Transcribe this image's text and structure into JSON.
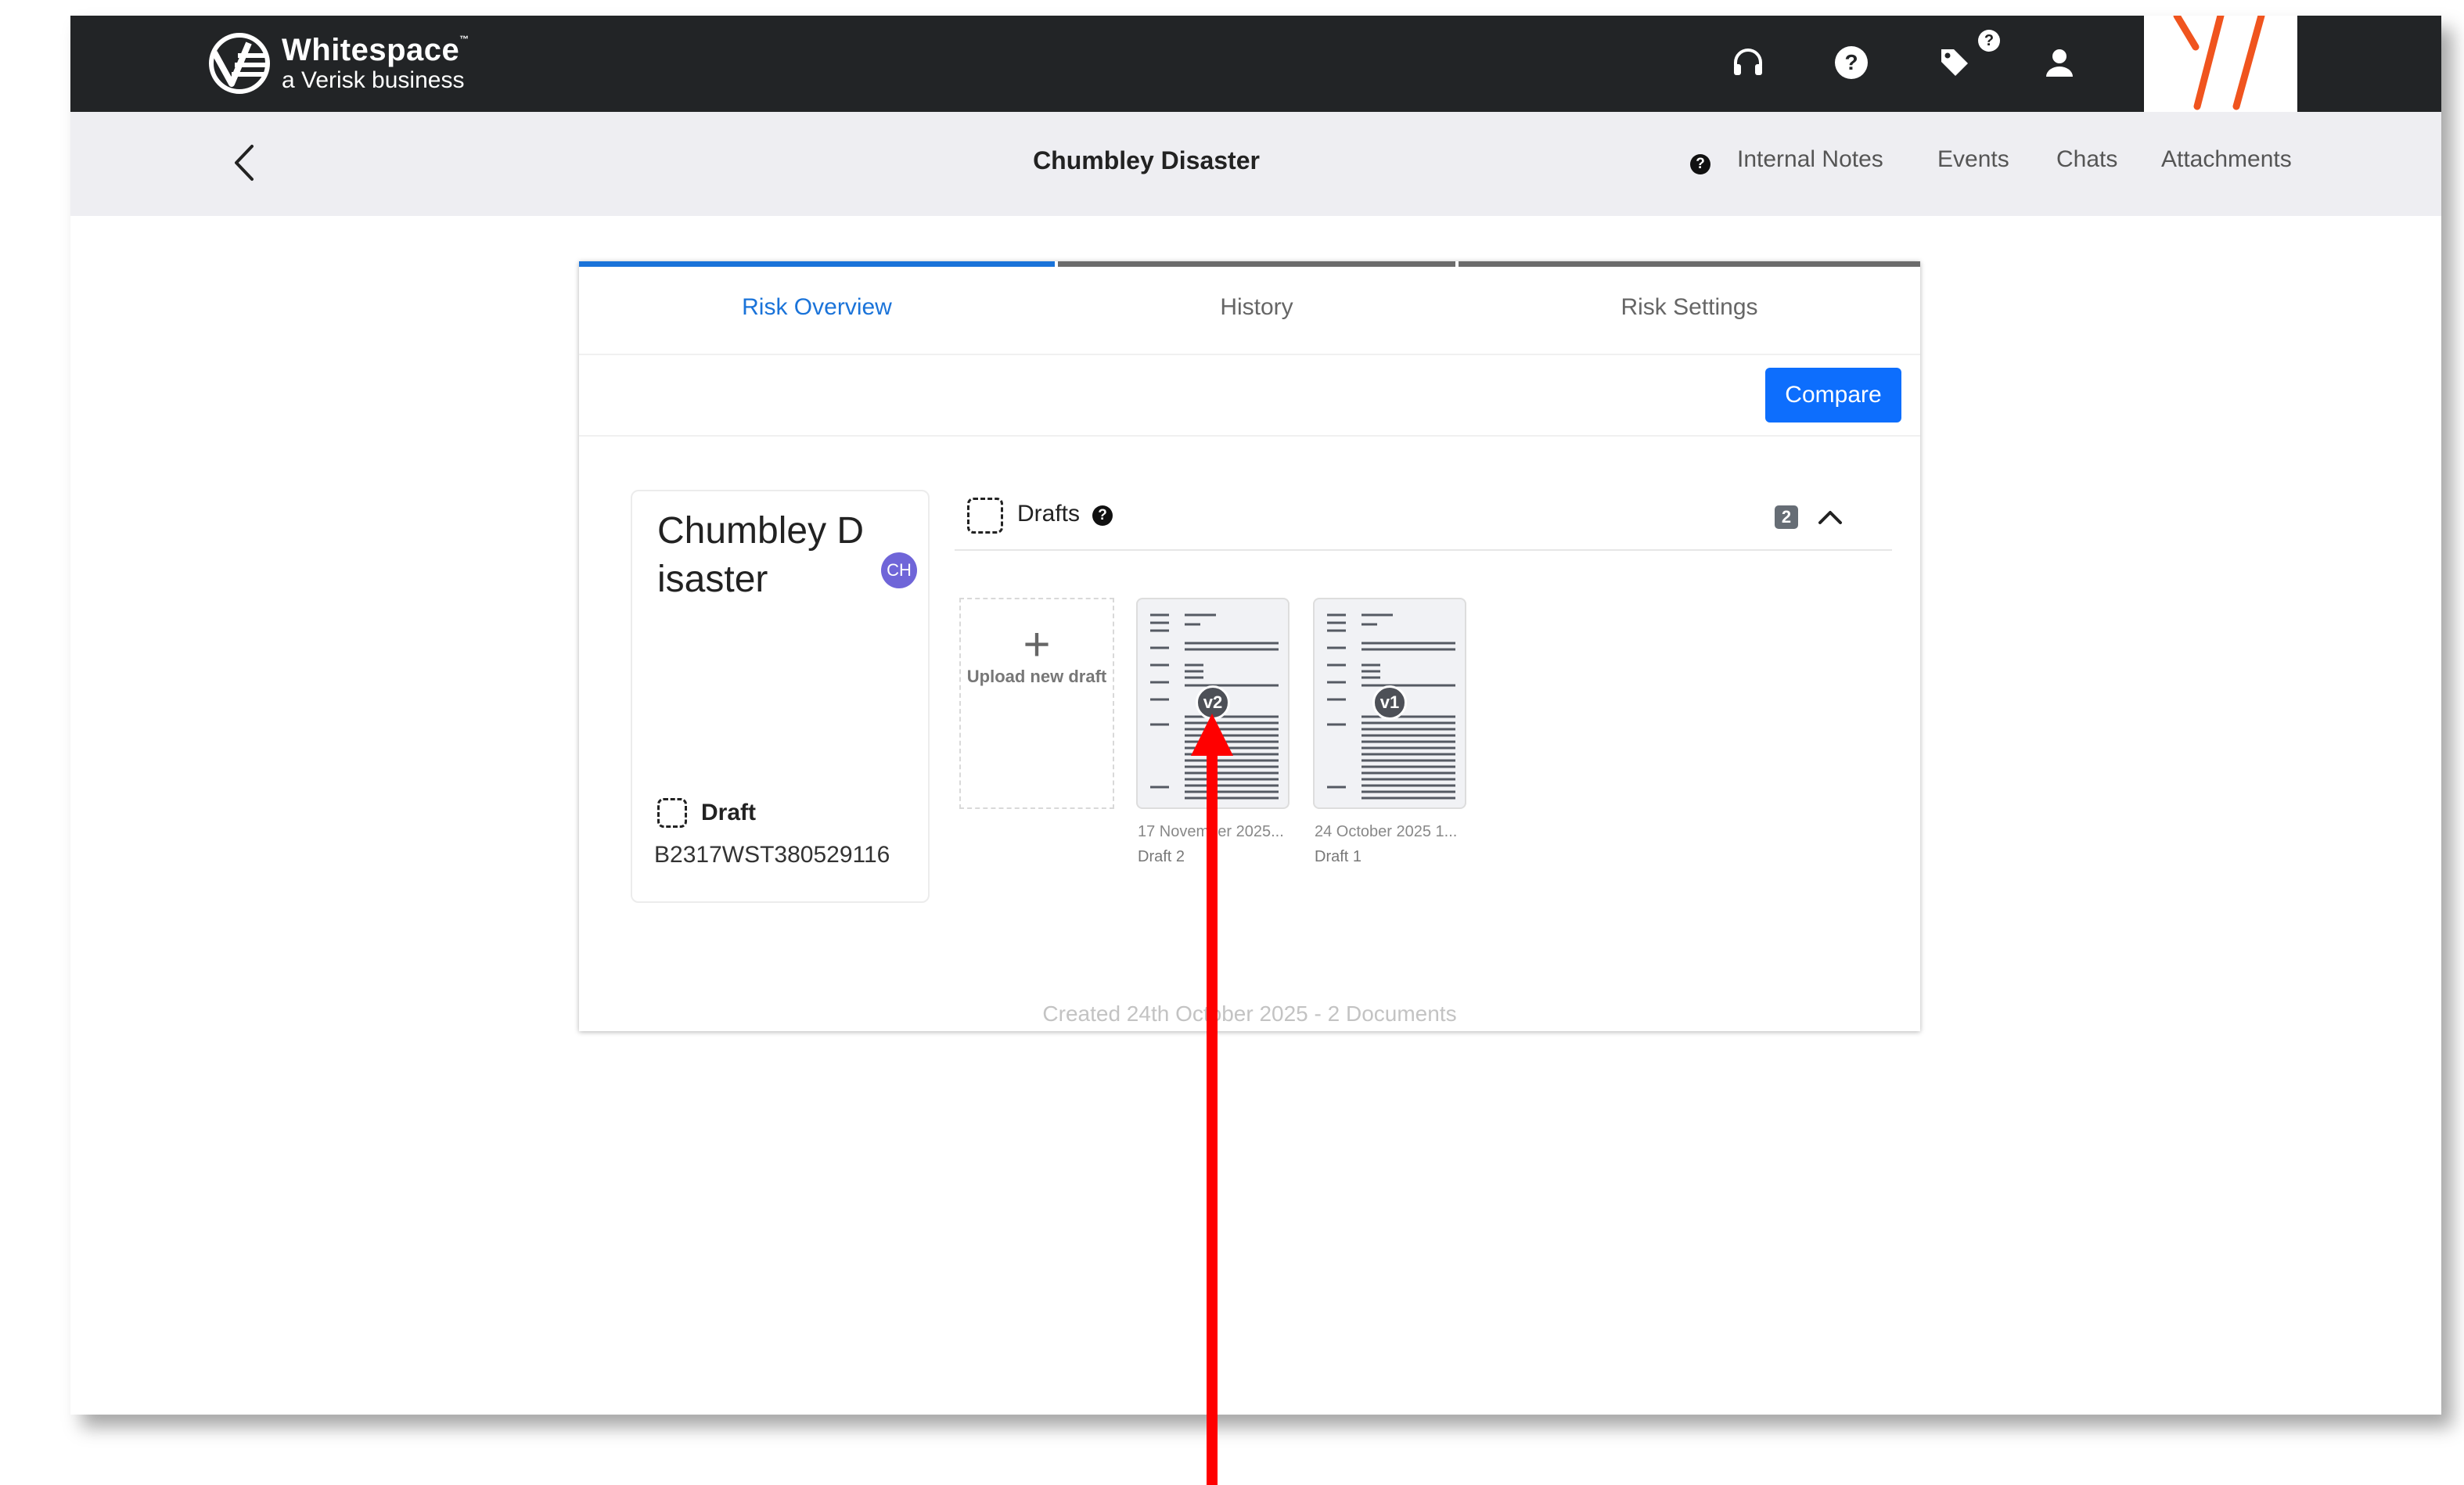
{
  "brand": {
    "name": "Whitespace",
    "trademark": "™",
    "tagline": "a Verisk business"
  },
  "topbar": {
    "icons": [
      "headset-icon",
      "help-icon",
      "tag-icon",
      "user-icon"
    ],
    "tag_badge": "?"
  },
  "header": {
    "title": "Chumbley Disaster",
    "help_mark": "?",
    "links": [
      "Internal Notes",
      "Events",
      "Chats",
      "Attachments"
    ]
  },
  "tabs": [
    {
      "label": "Risk Overview",
      "active": true
    },
    {
      "label": "History",
      "active": false
    },
    {
      "label": "Risk Settings",
      "active": false
    }
  ],
  "actions": {
    "compare_label": "Compare"
  },
  "risk": {
    "name": "Chumbley Disaster",
    "avatar_initials": "CH",
    "status": "Draft",
    "reference": "B2317WST380529116"
  },
  "drafts": {
    "title": "Drafts",
    "help_mark": "?",
    "count": "2",
    "upload_label": "Upload new draft",
    "documents": [
      {
        "version": "v2",
        "date": "17 November 2025...",
        "name": "Draft 2"
      },
      {
        "version": "v1",
        "date": "24 October 2025 1...",
        "name": "Draft 1"
      }
    ]
  },
  "footer": {
    "summary": "Created 24th October 2025 - 2 Documents"
  },
  "colors": {
    "topbar": "#222426",
    "subbar": "#eeeef2",
    "accent": "#0d6efd",
    "active_tab": "#1a73d9",
    "brand_orange": "#f0541e",
    "annotation_arrow": "#ff0000"
  }
}
